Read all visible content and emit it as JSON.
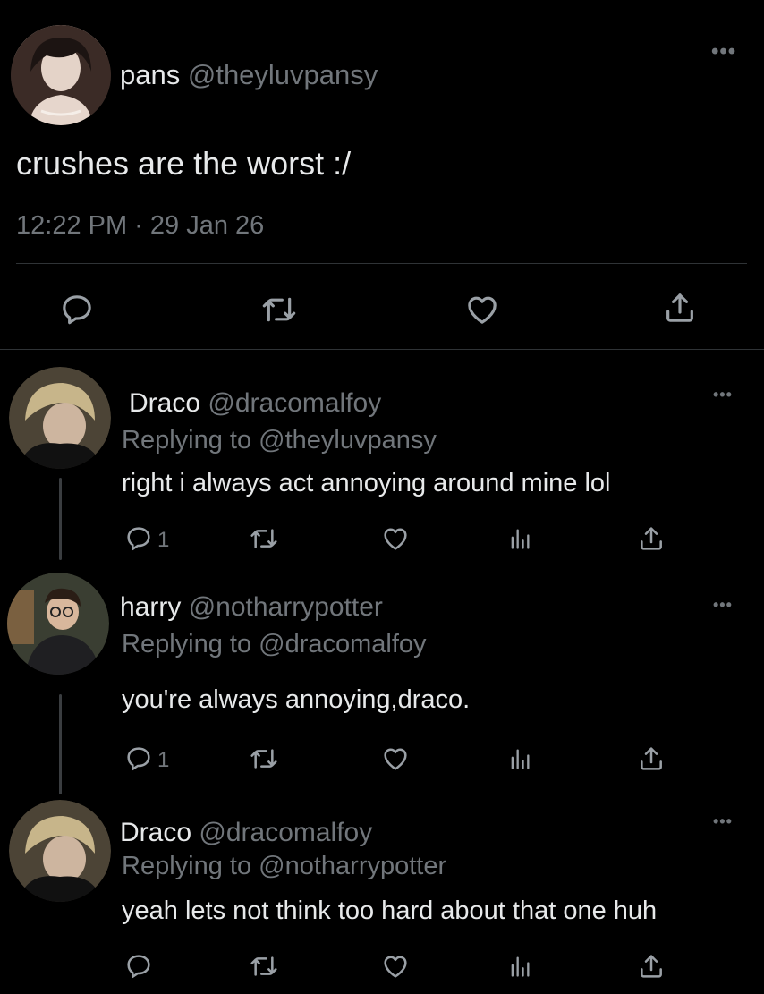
{
  "main_tweet": {
    "display_name": "pans",
    "handle": "@theyluvpansy",
    "text": "crushes are the worst :/",
    "timestamp": "12:22 PM · 29 Jan 26"
  },
  "replies": [
    {
      "display_name": "Draco",
      "handle": "@dracomalfoy",
      "replying_label": "Replying to",
      "replying_to": "@theyluvpansy",
      "text": "right i always act annoying around mine lol",
      "reply_count": "1"
    },
    {
      "display_name": "harry",
      "handle": "@notharrypotter",
      "replying_label": "Replying to",
      "replying_to": "@dracomalfoy",
      "text": "you're always annoying,draco.",
      "reply_count": "1"
    },
    {
      "display_name": "Draco",
      "handle": "@dracomalfoy",
      "replying_label": "Replying to",
      "replying_to": "@notharrypotter",
      "text": "yeah lets not think too hard about that one huh",
      "reply_count": ""
    }
  ],
  "colors": {
    "background": "#000000",
    "text": "#e7e9ea",
    "muted": "#71767b",
    "divider": "#2f3336"
  },
  "icons": {
    "reply": "speech-bubble-icon",
    "retweet": "retweet-icon",
    "like": "heart-icon",
    "views": "bar-chart-icon",
    "share": "share-icon",
    "more": "more-dots-icon"
  }
}
